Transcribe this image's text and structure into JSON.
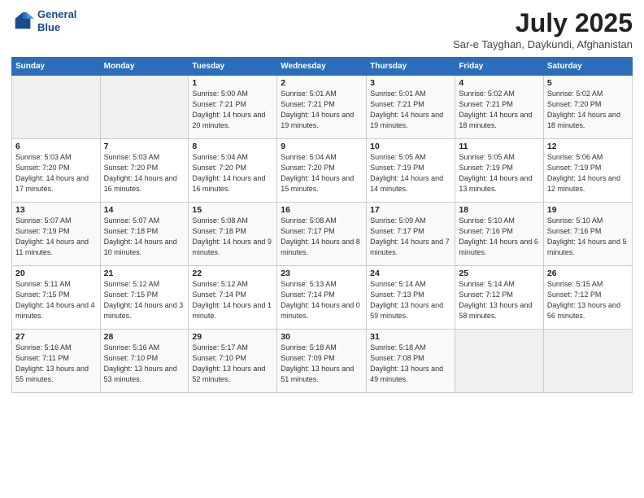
{
  "header": {
    "logo": {
      "line1": "General",
      "line2": "Blue"
    },
    "title": "July 2025",
    "subtitle": "Sar-e Tayghan, Daykundi, Afghanistan"
  },
  "calendar": {
    "days_of_week": [
      "Sunday",
      "Monday",
      "Tuesday",
      "Wednesday",
      "Thursday",
      "Friday",
      "Saturday"
    ],
    "weeks": [
      [
        {
          "day": "",
          "info": ""
        },
        {
          "day": "",
          "info": ""
        },
        {
          "day": "1",
          "info": "Sunrise: 5:00 AM\nSunset: 7:21 PM\nDaylight: 14 hours and 20 minutes."
        },
        {
          "day": "2",
          "info": "Sunrise: 5:01 AM\nSunset: 7:21 PM\nDaylight: 14 hours and 19 minutes."
        },
        {
          "day": "3",
          "info": "Sunrise: 5:01 AM\nSunset: 7:21 PM\nDaylight: 14 hours and 19 minutes."
        },
        {
          "day": "4",
          "info": "Sunrise: 5:02 AM\nSunset: 7:21 PM\nDaylight: 14 hours and 18 minutes."
        },
        {
          "day": "5",
          "info": "Sunrise: 5:02 AM\nSunset: 7:20 PM\nDaylight: 14 hours and 18 minutes."
        }
      ],
      [
        {
          "day": "6",
          "info": "Sunrise: 5:03 AM\nSunset: 7:20 PM\nDaylight: 14 hours and 17 minutes."
        },
        {
          "day": "7",
          "info": "Sunrise: 5:03 AM\nSunset: 7:20 PM\nDaylight: 14 hours and 16 minutes."
        },
        {
          "day": "8",
          "info": "Sunrise: 5:04 AM\nSunset: 7:20 PM\nDaylight: 14 hours and 16 minutes."
        },
        {
          "day": "9",
          "info": "Sunrise: 5:04 AM\nSunset: 7:20 PM\nDaylight: 14 hours and 15 minutes."
        },
        {
          "day": "10",
          "info": "Sunrise: 5:05 AM\nSunset: 7:19 PM\nDaylight: 14 hours and 14 minutes."
        },
        {
          "day": "11",
          "info": "Sunrise: 5:05 AM\nSunset: 7:19 PM\nDaylight: 14 hours and 13 minutes."
        },
        {
          "day": "12",
          "info": "Sunrise: 5:06 AM\nSunset: 7:19 PM\nDaylight: 14 hours and 12 minutes."
        }
      ],
      [
        {
          "day": "13",
          "info": "Sunrise: 5:07 AM\nSunset: 7:19 PM\nDaylight: 14 hours and 11 minutes."
        },
        {
          "day": "14",
          "info": "Sunrise: 5:07 AM\nSunset: 7:18 PM\nDaylight: 14 hours and 10 minutes."
        },
        {
          "day": "15",
          "info": "Sunrise: 5:08 AM\nSunset: 7:18 PM\nDaylight: 14 hours and 9 minutes."
        },
        {
          "day": "16",
          "info": "Sunrise: 5:08 AM\nSunset: 7:17 PM\nDaylight: 14 hours and 8 minutes."
        },
        {
          "day": "17",
          "info": "Sunrise: 5:09 AM\nSunset: 7:17 PM\nDaylight: 14 hours and 7 minutes."
        },
        {
          "day": "18",
          "info": "Sunrise: 5:10 AM\nSunset: 7:16 PM\nDaylight: 14 hours and 6 minutes."
        },
        {
          "day": "19",
          "info": "Sunrise: 5:10 AM\nSunset: 7:16 PM\nDaylight: 14 hours and 5 minutes."
        }
      ],
      [
        {
          "day": "20",
          "info": "Sunrise: 5:11 AM\nSunset: 7:15 PM\nDaylight: 14 hours and 4 minutes."
        },
        {
          "day": "21",
          "info": "Sunrise: 5:12 AM\nSunset: 7:15 PM\nDaylight: 14 hours and 3 minutes."
        },
        {
          "day": "22",
          "info": "Sunrise: 5:12 AM\nSunset: 7:14 PM\nDaylight: 14 hours and 1 minute."
        },
        {
          "day": "23",
          "info": "Sunrise: 5:13 AM\nSunset: 7:14 PM\nDaylight: 14 hours and 0 minutes."
        },
        {
          "day": "24",
          "info": "Sunrise: 5:14 AM\nSunset: 7:13 PM\nDaylight: 13 hours and 59 minutes."
        },
        {
          "day": "25",
          "info": "Sunrise: 5:14 AM\nSunset: 7:12 PM\nDaylight: 13 hours and 58 minutes."
        },
        {
          "day": "26",
          "info": "Sunrise: 5:15 AM\nSunset: 7:12 PM\nDaylight: 13 hours and 56 minutes."
        }
      ],
      [
        {
          "day": "27",
          "info": "Sunrise: 5:16 AM\nSunset: 7:11 PM\nDaylight: 13 hours and 55 minutes."
        },
        {
          "day": "28",
          "info": "Sunrise: 5:16 AM\nSunset: 7:10 PM\nDaylight: 13 hours and 53 minutes."
        },
        {
          "day": "29",
          "info": "Sunrise: 5:17 AM\nSunset: 7:10 PM\nDaylight: 13 hours and 52 minutes."
        },
        {
          "day": "30",
          "info": "Sunrise: 5:18 AM\nSunset: 7:09 PM\nDaylight: 13 hours and 51 minutes."
        },
        {
          "day": "31",
          "info": "Sunrise: 5:18 AM\nSunset: 7:08 PM\nDaylight: 13 hours and 49 minutes."
        },
        {
          "day": "",
          "info": ""
        },
        {
          "day": "",
          "info": ""
        }
      ]
    ]
  }
}
